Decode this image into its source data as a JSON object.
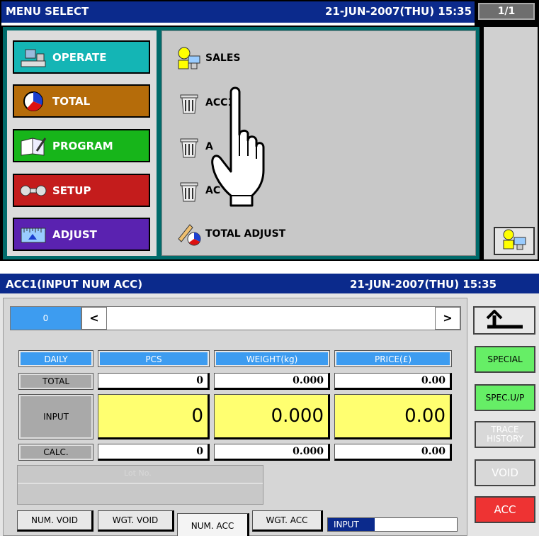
{
  "top": {
    "title": "MENU SELECT",
    "datetime": "21-JUN-2007(THU) 15:35",
    "page_indicator": "1/1",
    "categories": [
      {
        "label": "OPERATE",
        "color": "#14b5b5"
      },
      {
        "label": "TOTAL",
        "color": "#b56c0a"
      },
      {
        "label": "PROGRAM",
        "color": "#17b51a"
      },
      {
        "label": "SETUP",
        "color": "#c41c1c"
      },
      {
        "label": "ADJUST",
        "color": "#5a22b0"
      }
    ],
    "menu_items": [
      {
        "label": "SALES",
        "icon": "sales-person-icon"
      },
      {
        "label": "ACC1",
        "icon": "trash-bin-icon"
      },
      {
        "label": "A",
        "icon": "trash-bin-icon"
      },
      {
        "label": "AC",
        "icon": "trash-bin-icon"
      },
      {
        "label": "TOTAL ADJUST",
        "icon": "pen-chart-icon"
      }
    ]
  },
  "bottom": {
    "title": "ACC1(INPUT NUM ACC)",
    "datetime": "21-JUN-2007(THU) 15:35",
    "lot_button": "0",
    "nav_prev": "<",
    "nav_next": ">",
    "headers": [
      "DAILY",
      "PCS",
      "WEIGHT(kg)",
      "PRICE(£)"
    ],
    "rows": [
      {
        "label": "TOTAL",
        "pcs": "0",
        "weight": "0.000",
        "price": "0.00"
      },
      {
        "label": "INPUT",
        "pcs": "0",
        "weight": "0.000",
        "price": "0.00"
      },
      {
        "label": "CALC.",
        "pcs": "0",
        "weight": "0.000",
        "price": "0.00"
      }
    ],
    "lot_label": "Lot No.",
    "tabs": [
      "NUM. VOID",
      "WGT. VOID",
      "NUM. ACC",
      "WGT. ACC"
    ],
    "active_tab": "NUM. ACC",
    "status": "INPUT",
    "side_buttons": {
      "special": "SPECIAL",
      "spec_up": "SPEC.U/P",
      "trace_history_1": "TRACE",
      "trace_history_2": "HISTORY",
      "void": "VOID",
      "acc": "ACC"
    }
  }
}
